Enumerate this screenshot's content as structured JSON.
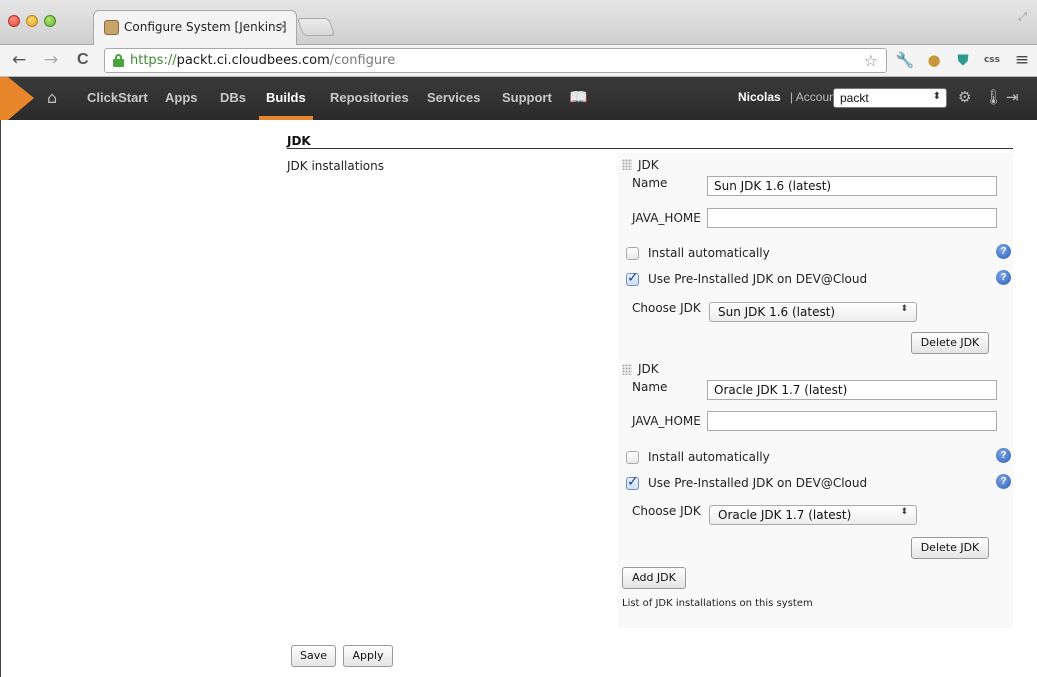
{
  "browser": {
    "tab_title": "Configure System [Jenkins]",
    "tab_close": "×",
    "url_scheme": "https://",
    "url_host": "packt.ci.cloudbees.com",
    "url_path": "/configure",
    "back_icon": "←",
    "forward_icon": "→",
    "reload_icon": "C",
    "star_icon": "☆",
    "extension_icons": [
      "wrench-icon",
      "cookie-icon",
      "shield-icon",
      "css-icon",
      "menu-icon"
    ]
  },
  "header": {
    "home_icon": "home-icon",
    "nav": [
      "ClickStart",
      "Apps",
      "DBs",
      "Builds",
      "Repositories",
      "Services",
      "Support"
    ],
    "active_nav": "Builds",
    "book_icon": "book-icon",
    "user_name": "Nicolas",
    "account_label": "| Account:",
    "account_value": "packt",
    "accent_color": "#e8862c"
  },
  "section": {
    "title": "JDK",
    "field_label": "JDK installations",
    "description": "List of JDK installations on this system",
    "add_button": "Add JDK"
  },
  "jdks": [
    {
      "header": "JDK",
      "name_label": "Name",
      "name_value": "Sun JDK 1.6 (latest)",
      "java_home_label": "JAVA_HOME",
      "java_home_value": "",
      "install_auto_label": "Install automatically",
      "install_auto_checked": false,
      "preinstalled_label": "Use Pre-Installed JDK on DEV@Cloud",
      "preinstalled_checked": true,
      "choose_label": "Choose JDK",
      "choose_value": "Sun JDK 1.6 (latest)",
      "delete_button": "Delete JDK"
    },
    {
      "header": "JDK",
      "name_label": "Name",
      "name_value": "Oracle JDK 1.7 (latest)",
      "java_home_label": "JAVA_HOME",
      "java_home_value": "",
      "install_auto_label": "Install automatically",
      "install_auto_checked": false,
      "preinstalled_label": "Use Pre-Installed JDK on DEV@Cloud",
      "preinstalled_checked": true,
      "choose_label": "Choose JDK",
      "choose_value": "Oracle JDK 1.7 (latest)",
      "delete_button": "Delete JDK"
    }
  ],
  "footer": {
    "save_button": "Save",
    "apply_button": "Apply"
  }
}
